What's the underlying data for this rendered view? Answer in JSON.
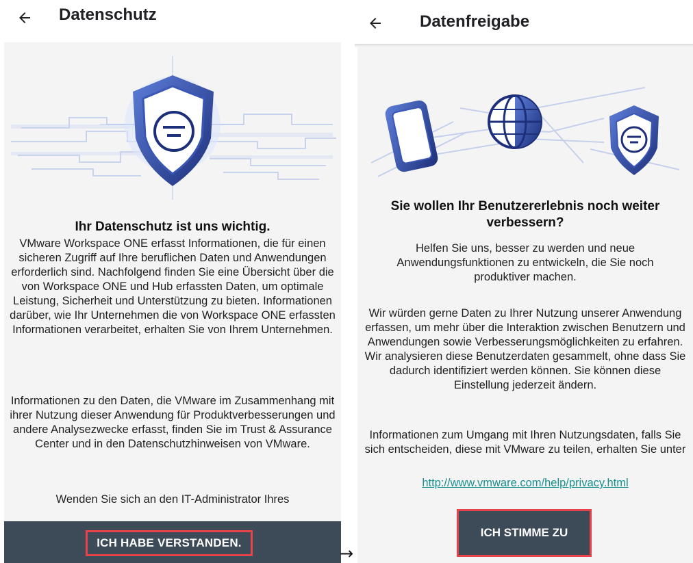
{
  "left": {
    "title": "Datenschutz",
    "heading": "Ihr Datenschutz ist uns wichtig.",
    "para1": "VMware Workspace ONE erfasst Informationen, die für einen sicheren Zugriff auf Ihre beruflichen Daten und Anwendungen erforderlich sind. Nachfolgend finden Sie eine Übersicht über die von Workspace ONE und Hub erfassten Daten, um optimale Leistung, Sicherheit und Unterstützung zu bieten. Informationen darüber, wie Ihr Unternehmen die von Workspace ONE erfassten Informationen verarbeitet, erhalten Sie von Ihrem Unternehmen.",
    "para2": "Informationen zu den Daten, die VMware im Zusammenhang mit ihrer Nutzung dieser Anwendung für Produktverbesserungen und andere Analysezwecke erfasst, finden Sie im Trust & Assurance Center und in den Datenschutzhinweisen von VMware.",
    "para3": "Wenden Sie sich an den IT-Administrator Ihres",
    "button": "ICH HABE VERSTANDEN."
  },
  "right": {
    "title": "Datenfreigabe",
    "heading": "Sie wollen Ihr Benutzererlebnis noch weiter verbessern?",
    "para1": "Helfen Sie uns, besser zu werden und neue Anwendungsfunktionen zu entwickeln, die Sie noch produktiver machen.",
    "para2": "Wir würden gerne Daten zu Ihrer Nutzung unserer Anwendung erfassen, um mehr über die Interaktion zwischen Benutzern und Anwendungen sowie Verbesserungsmöglichkeiten zu erfahren. Wir analysieren diese Benutzerdaten gesammelt, ohne dass Sie dadurch identifiziert werden können. Sie können diese Einstellung jederzeit ändern.",
    "para3": "Informationen zum Umgang mit Ihren Nutzungsdaten, falls Sie sich entscheiden, diese mit VMware zu teilen, erhalten Sie unter",
    "link": "http://www.vmware.com/help/privacy.html",
    "button": "ICH STIMME ZU"
  },
  "between_arrow": "→",
  "icons": [
    "back-arrow-icon",
    "shield-icon",
    "phone-icon",
    "globe-icon"
  ],
  "colors": {
    "accent_red": "#e8424a",
    "footer": "#3d4b59",
    "link": "#1a8f8f",
    "illustration_blue": "#2f4fa8"
  }
}
